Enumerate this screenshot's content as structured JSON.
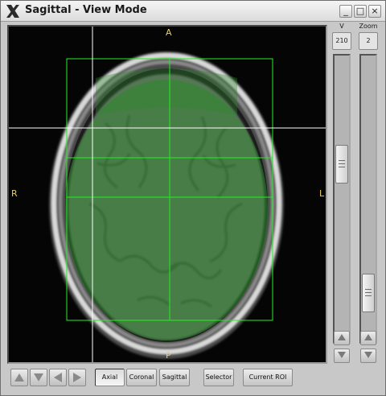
{
  "window": {
    "title": "Sagittal - View Mode",
    "controls": {
      "minimize": "_",
      "maximize": "□",
      "close": "×"
    }
  },
  "viewer": {
    "orientation": {
      "top": "A",
      "bottom": "P",
      "left": "R",
      "right": "L"
    },
    "overlay_color": "#2a8a2a",
    "grid_color": "#22ee22",
    "crosshair_color": "#ffffff",
    "label_color": "#e8d060"
  },
  "sliders": {
    "v": {
      "label": "V",
      "value": "210",
      "level": 0.36
    },
    "zoom": {
      "label": "Zoom",
      "value": "2",
      "level": 0.88
    }
  },
  "toolbar": {
    "nav_icons": [
      "arrow-up-icon",
      "arrow-down-icon",
      "arrow-left-icon",
      "arrow-right-icon"
    ],
    "view_buttons": [
      {
        "label": "Axial",
        "active": true
      },
      {
        "label": "Coronal",
        "active": false
      },
      {
        "label": "Sagittal",
        "active": false
      }
    ],
    "selector_label": "Selector",
    "roi_label": "Current ROI"
  }
}
